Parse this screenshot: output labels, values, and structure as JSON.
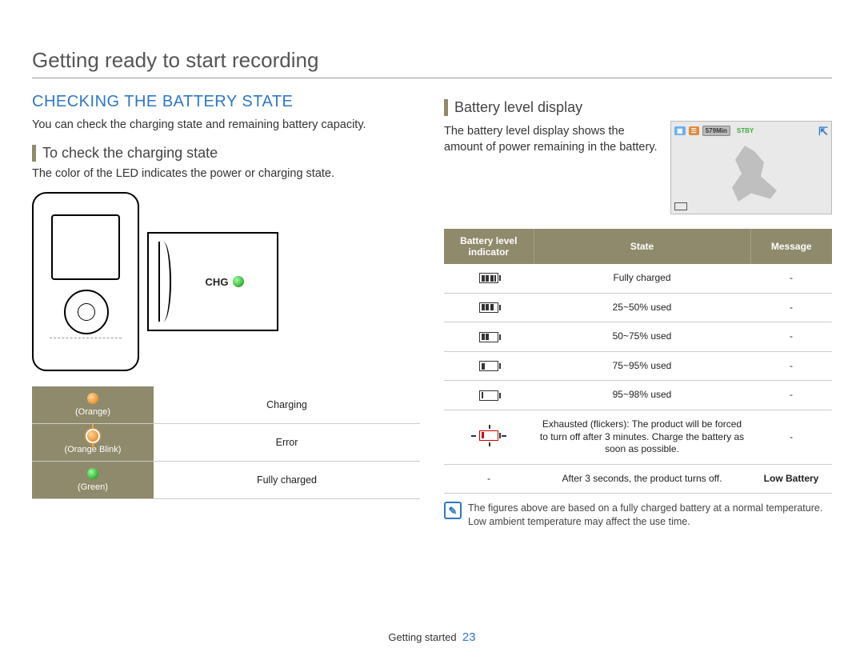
{
  "page_title": "Getting ready to start recording",
  "section_heading": "CHECKING THE BATTERY STATE",
  "intro": "You can check the charging state and remaining battery capacity.",
  "sub1": "To check the charging state",
  "sub1_text": "The color of the LED indicates the power or charging state.",
  "chg_label": "CHG",
  "led_table": [
    {
      "label": "(Orange)",
      "meaning": "Charging"
    },
    {
      "label": "(Orange Blink)",
      "meaning": "Error"
    },
    {
      "label": "(Green)",
      "meaning": "Fully charged"
    }
  ],
  "sub2": "Battery level display",
  "sub2_text": "The battery level display shows the amount of power remaining in the battery.",
  "preview": {
    "time": "579Min",
    "stby": "STBY"
  },
  "batt_headers": [
    "Battery level indicator",
    "State",
    "Message"
  ],
  "batt_rows": [
    {
      "bars": 4,
      "state": "Fully charged",
      "msg": "-"
    },
    {
      "bars": 3,
      "state": "25~50% used",
      "msg": "-"
    },
    {
      "bars": 2,
      "state": "50~75% used",
      "msg": "-"
    },
    {
      "bars": 1,
      "state": "75~95% used",
      "msg": "-"
    },
    {
      "bars": 0.5,
      "state": "95~98% used",
      "msg": "-"
    },
    {
      "bars": -1,
      "state": "Exhausted (flickers): The product will be forced to turn off after 3 minutes. Charge the battery as soon as possible.",
      "msg": "-"
    },
    {
      "bars": -2,
      "state": "After 3 seconds, the product turns off.",
      "msg": "Low Battery"
    }
  ],
  "note": "The figures above are based on a fully charged battery at a normal temperature. Low ambient temperature may affect the use time.",
  "footer_section": "Getting started",
  "page_number": "23"
}
